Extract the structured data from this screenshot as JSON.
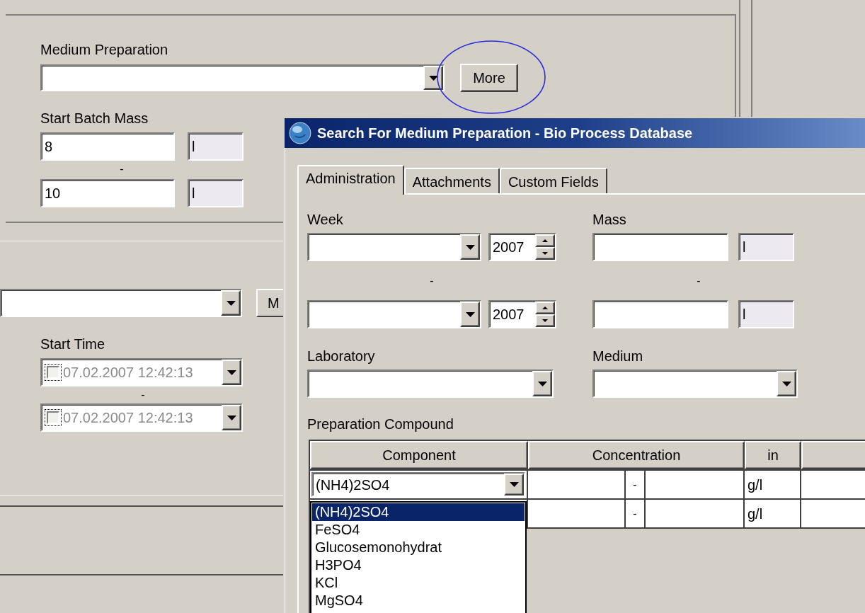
{
  "main_form": {
    "medium_preparation": {
      "label": "Medium Preparation",
      "button": "More"
    },
    "start_batch_mass": {
      "label": "Start Batch Mass",
      "from": {
        "value": "8",
        "unit": "l"
      },
      "separator": "-",
      "to": {
        "value": "10",
        "unit": "l"
      }
    },
    "second_section": {
      "button": "M"
    },
    "start_time": {
      "label": "Start Time",
      "separator": "-",
      "from": {
        "checked": false,
        "disabled": true,
        "value": "07.02.2007 12:42:13"
      },
      "to": {
        "checked": false,
        "disabled": true,
        "value": "07.02.2007 12:42:13"
      }
    }
  },
  "dialog": {
    "title": "Search For Medium Preparation - Bio Process Database",
    "tabs": [
      {
        "label": "Administration",
        "selected": true
      },
      {
        "label": "Attachments",
        "selected": false
      },
      {
        "label": "Custom Fields",
        "selected": false
      }
    ],
    "week": {
      "label": "Week",
      "separator": "-",
      "from": {
        "year": "2007"
      },
      "to": {
        "year": "2007"
      }
    },
    "mass": {
      "label": "Mass",
      "separator": "-",
      "from": {
        "unit": "l"
      },
      "to": {
        "unit": "l"
      }
    },
    "laboratory": {
      "label": "Laboratory"
    },
    "medium": {
      "label": "Medium"
    },
    "preparation_compound": {
      "label": "Preparation Compound",
      "columns": [
        "Component",
        "Concentration",
        "in"
      ],
      "rows": [
        {
          "component": "(NH4)2SO4",
          "separator": "-",
          "unit": "g/l"
        },
        {
          "separator": "-",
          "unit": "g/l"
        }
      ],
      "dropdown": [
        {
          "label": "(NH4)2SO4",
          "selected": true
        },
        {
          "label": "FeSO4",
          "selected": false
        },
        {
          "label": "Glucosemonohydrat",
          "selected": false
        },
        {
          "label": "H3PO4",
          "selected": false
        },
        {
          "label": "KCl",
          "selected": false
        },
        {
          "label": "MgSO4",
          "selected": false
        }
      ]
    }
  }
}
